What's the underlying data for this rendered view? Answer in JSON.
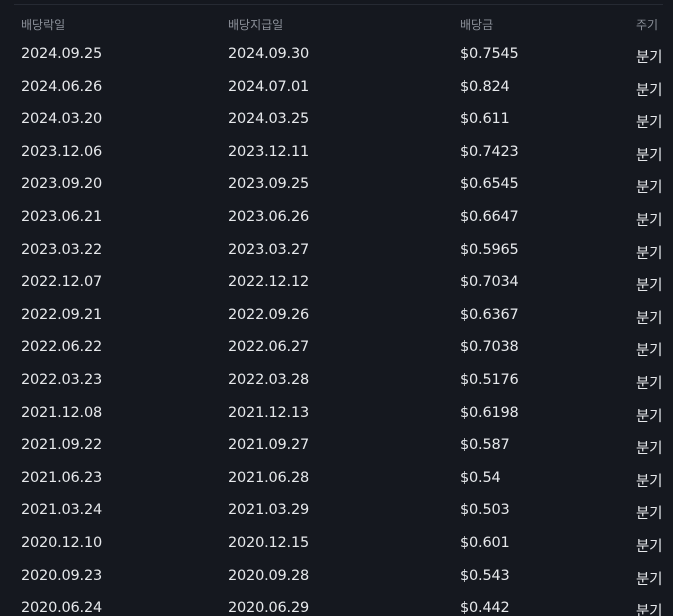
{
  "headers": {
    "ex_date": "배당락일",
    "pay_date": "배당지급일",
    "amount": "배당금",
    "cycle": "주기"
  },
  "rows": [
    {
      "ex_date": "2024.09.25",
      "pay_date": "2024.09.30",
      "amount": "$0.7545",
      "cycle": "분기"
    },
    {
      "ex_date": "2024.06.26",
      "pay_date": "2024.07.01",
      "amount": "$0.824",
      "cycle": "분기"
    },
    {
      "ex_date": "2024.03.20",
      "pay_date": "2024.03.25",
      "amount": "$0.611",
      "cycle": "분기"
    },
    {
      "ex_date": "2023.12.06",
      "pay_date": "2023.12.11",
      "amount": "$0.7423",
      "cycle": "분기"
    },
    {
      "ex_date": "2023.09.20",
      "pay_date": "2023.09.25",
      "amount": "$0.6545",
      "cycle": "분기"
    },
    {
      "ex_date": "2023.06.21",
      "pay_date": "2023.06.26",
      "amount": "$0.6647",
      "cycle": "분기"
    },
    {
      "ex_date": "2023.03.22",
      "pay_date": "2023.03.27",
      "amount": "$0.5965",
      "cycle": "분기"
    },
    {
      "ex_date": "2022.12.07",
      "pay_date": "2022.12.12",
      "amount": "$0.7034",
      "cycle": "분기"
    },
    {
      "ex_date": "2022.09.21",
      "pay_date": "2022.09.26",
      "amount": "$0.6367",
      "cycle": "분기"
    },
    {
      "ex_date": "2022.06.22",
      "pay_date": "2022.06.27",
      "amount": "$0.7038",
      "cycle": "분기"
    },
    {
      "ex_date": "2022.03.23",
      "pay_date": "2022.03.28",
      "amount": "$0.5176",
      "cycle": "분기"
    },
    {
      "ex_date": "2021.12.08",
      "pay_date": "2021.12.13",
      "amount": "$0.6198",
      "cycle": "분기"
    },
    {
      "ex_date": "2021.09.22",
      "pay_date": "2021.09.27",
      "amount": "$0.587",
      "cycle": "분기"
    },
    {
      "ex_date": "2021.06.23",
      "pay_date": "2021.06.28",
      "amount": "$0.54",
      "cycle": "분기"
    },
    {
      "ex_date": "2021.03.24",
      "pay_date": "2021.03.29",
      "amount": "$0.503",
      "cycle": "분기"
    },
    {
      "ex_date": "2020.12.10",
      "pay_date": "2020.12.15",
      "amount": "$0.601",
      "cycle": "분기"
    },
    {
      "ex_date": "2020.09.23",
      "pay_date": "2020.09.28",
      "amount": "$0.543",
      "cycle": "분기"
    },
    {
      "ex_date": "2020.06.24",
      "pay_date": "2020.06.29",
      "amount": "$0.442",
      "cycle": "분기"
    }
  ]
}
